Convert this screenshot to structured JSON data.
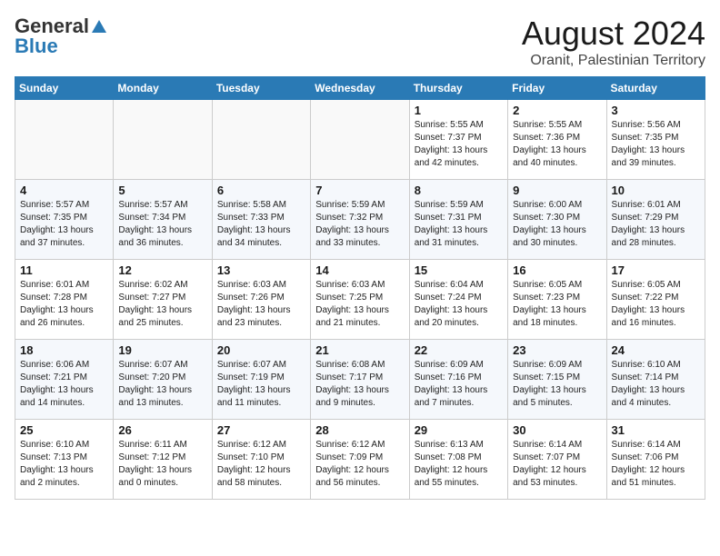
{
  "header": {
    "logo_general": "General",
    "logo_blue": "Blue",
    "month_title": "August 2024",
    "location": "Oranit, Palestinian Territory"
  },
  "days_of_week": [
    "Sunday",
    "Monday",
    "Tuesday",
    "Wednesday",
    "Thursday",
    "Friday",
    "Saturday"
  ],
  "weeks": [
    [
      {
        "day": "",
        "info": ""
      },
      {
        "day": "",
        "info": ""
      },
      {
        "day": "",
        "info": ""
      },
      {
        "day": "",
        "info": ""
      },
      {
        "day": "1",
        "info": "Sunrise: 5:55 AM\nSunset: 7:37 PM\nDaylight: 13 hours and 42 minutes."
      },
      {
        "day": "2",
        "info": "Sunrise: 5:55 AM\nSunset: 7:36 PM\nDaylight: 13 hours and 40 minutes."
      },
      {
        "day": "3",
        "info": "Sunrise: 5:56 AM\nSunset: 7:35 PM\nDaylight: 13 hours and 39 minutes."
      }
    ],
    [
      {
        "day": "4",
        "info": "Sunrise: 5:57 AM\nSunset: 7:35 PM\nDaylight: 13 hours and 37 minutes."
      },
      {
        "day": "5",
        "info": "Sunrise: 5:57 AM\nSunset: 7:34 PM\nDaylight: 13 hours and 36 minutes."
      },
      {
        "day": "6",
        "info": "Sunrise: 5:58 AM\nSunset: 7:33 PM\nDaylight: 13 hours and 34 minutes."
      },
      {
        "day": "7",
        "info": "Sunrise: 5:59 AM\nSunset: 7:32 PM\nDaylight: 13 hours and 33 minutes."
      },
      {
        "day": "8",
        "info": "Sunrise: 5:59 AM\nSunset: 7:31 PM\nDaylight: 13 hours and 31 minutes."
      },
      {
        "day": "9",
        "info": "Sunrise: 6:00 AM\nSunset: 7:30 PM\nDaylight: 13 hours and 30 minutes."
      },
      {
        "day": "10",
        "info": "Sunrise: 6:01 AM\nSunset: 7:29 PM\nDaylight: 13 hours and 28 minutes."
      }
    ],
    [
      {
        "day": "11",
        "info": "Sunrise: 6:01 AM\nSunset: 7:28 PM\nDaylight: 13 hours and 26 minutes."
      },
      {
        "day": "12",
        "info": "Sunrise: 6:02 AM\nSunset: 7:27 PM\nDaylight: 13 hours and 25 minutes."
      },
      {
        "day": "13",
        "info": "Sunrise: 6:03 AM\nSunset: 7:26 PM\nDaylight: 13 hours and 23 minutes."
      },
      {
        "day": "14",
        "info": "Sunrise: 6:03 AM\nSunset: 7:25 PM\nDaylight: 13 hours and 21 minutes."
      },
      {
        "day": "15",
        "info": "Sunrise: 6:04 AM\nSunset: 7:24 PM\nDaylight: 13 hours and 20 minutes."
      },
      {
        "day": "16",
        "info": "Sunrise: 6:05 AM\nSunset: 7:23 PM\nDaylight: 13 hours and 18 minutes."
      },
      {
        "day": "17",
        "info": "Sunrise: 6:05 AM\nSunset: 7:22 PM\nDaylight: 13 hours and 16 minutes."
      }
    ],
    [
      {
        "day": "18",
        "info": "Sunrise: 6:06 AM\nSunset: 7:21 PM\nDaylight: 13 hours and 14 minutes."
      },
      {
        "day": "19",
        "info": "Sunrise: 6:07 AM\nSunset: 7:20 PM\nDaylight: 13 hours and 13 minutes."
      },
      {
        "day": "20",
        "info": "Sunrise: 6:07 AM\nSunset: 7:19 PM\nDaylight: 13 hours and 11 minutes."
      },
      {
        "day": "21",
        "info": "Sunrise: 6:08 AM\nSunset: 7:17 PM\nDaylight: 13 hours and 9 minutes."
      },
      {
        "day": "22",
        "info": "Sunrise: 6:09 AM\nSunset: 7:16 PM\nDaylight: 13 hours and 7 minutes."
      },
      {
        "day": "23",
        "info": "Sunrise: 6:09 AM\nSunset: 7:15 PM\nDaylight: 13 hours and 5 minutes."
      },
      {
        "day": "24",
        "info": "Sunrise: 6:10 AM\nSunset: 7:14 PM\nDaylight: 13 hours and 4 minutes."
      }
    ],
    [
      {
        "day": "25",
        "info": "Sunrise: 6:10 AM\nSunset: 7:13 PM\nDaylight: 13 hours and 2 minutes."
      },
      {
        "day": "26",
        "info": "Sunrise: 6:11 AM\nSunset: 7:12 PM\nDaylight: 13 hours and 0 minutes."
      },
      {
        "day": "27",
        "info": "Sunrise: 6:12 AM\nSunset: 7:10 PM\nDaylight: 12 hours and 58 minutes."
      },
      {
        "day": "28",
        "info": "Sunrise: 6:12 AM\nSunset: 7:09 PM\nDaylight: 12 hours and 56 minutes."
      },
      {
        "day": "29",
        "info": "Sunrise: 6:13 AM\nSunset: 7:08 PM\nDaylight: 12 hours and 55 minutes."
      },
      {
        "day": "30",
        "info": "Sunrise: 6:14 AM\nSunset: 7:07 PM\nDaylight: 12 hours and 53 minutes."
      },
      {
        "day": "31",
        "info": "Sunrise: 6:14 AM\nSunset: 7:06 PM\nDaylight: 12 hours and 51 minutes."
      }
    ]
  ]
}
